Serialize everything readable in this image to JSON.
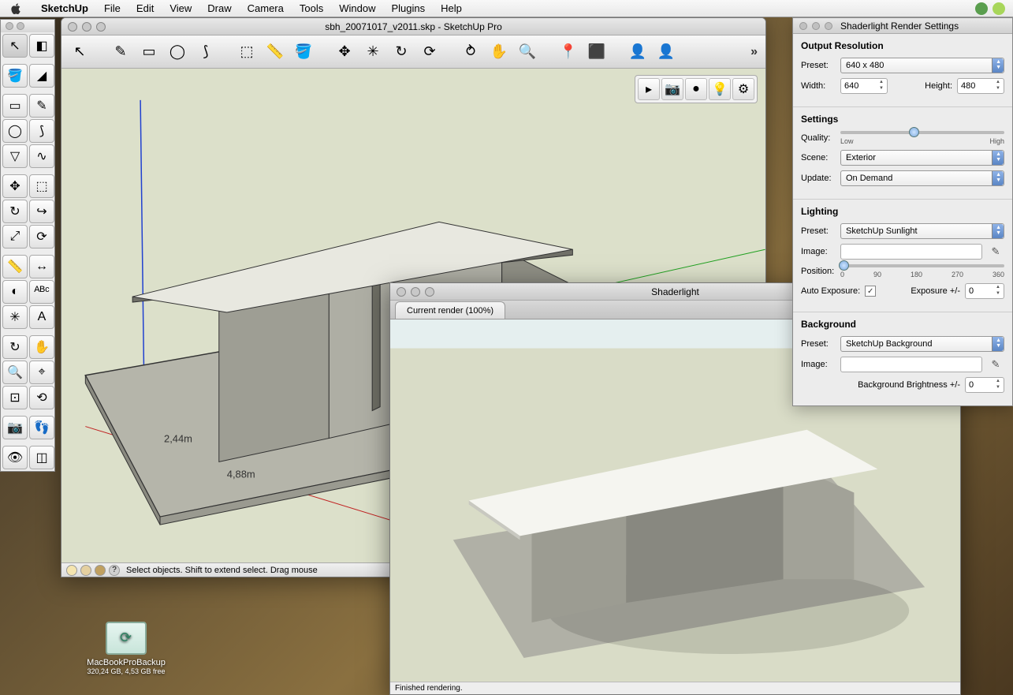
{
  "menubar": {
    "app": "SketchUp",
    "items": [
      "File",
      "Edit",
      "View",
      "Draw",
      "Camera",
      "Tools",
      "Window",
      "Plugins",
      "Help"
    ]
  },
  "doc": {
    "title": "sbh_20071017_v2011.skp - SketchUp Pro",
    "statusText": "Select objects. Shift to extend select. Drag mouse",
    "dim1": "2,44m",
    "dim2": "4,88m"
  },
  "palette": {
    "tools": [
      {
        "name": "select-tool",
        "glyph": "↖"
      },
      {
        "name": "make-component-tool",
        "glyph": "◧"
      },
      {
        "name": "paint-bucket-tool",
        "glyph": "🪣"
      },
      {
        "name": "eraser-tool",
        "glyph": "◢"
      },
      {
        "name": "rectangle-tool",
        "glyph": "▭"
      },
      {
        "name": "line-tool",
        "glyph": "✎"
      },
      {
        "name": "circle-tool",
        "glyph": "◯"
      },
      {
        "name": "arc-tool",
        "glyph": "⟆"
      },
      {
        "name": "polygon-tool",
        "glyph": "▽"
      },
      {
        "name": "freehand-tool",
        "glyph": "∿"
      },
      {
        "name": "move-tool",
        "glyph": "✥"
      },
      {
        "name": "pushpull-tool",
        "glyph": "⬚"
      },
      {
        "name": "rotate-tool",
        "glyph": "↻"
      },
      {
        "name": "followme-tool",
        "glyph": "↪"
      },
      {
        "name": "scale-tool",
        "glyph": "⤢"
      },
      {
        "name": "offset-tool",
        "glyph": "⟳"
      },
      {
        "name": "tape-tool",
        "glyph": "📏"
      },
      {
        "name": "dimension-tool",
        "glyph": "↔"
      },
      {
        "name": "protractor-tool",
        "glyph": "◐"
      },
      {
        "name": "text-tool",
        "glyph": "ᴬᴮᶜ"
      },
      {
        "name": "axes-tool",
        "glyph": "✳"
      },
      {
        "name": "3dtext-tool",
        "glyph": "A"
      },
      {
        "name": "orbit-tool",
        "glyph": "↻"
      },
      {
        "name": "pan-tool",
        "glyph": "✋"
      },
      {
        "name": "zoom-tool",
        "glyph": "🔍"
      },
      {
        "name": "zoomwindow-tool",
        "glyph": "⌖"
      },
      {
        "name": "zoomextents-tool",
        "glyph": "⊡"
      },
      {
        "name": "previous-tool",
        "glyph": "⟲"
      },
      {
        "name": "position-camera-tool",
        "glyph": "📷"
      },
      {
        "name": "walk-tool",
        "glyph": "👣"
      },
      {
        "name": "look-around-tool",
        "glyph": "👁"
      },
      {
        "name": "section-plane-tool",
        "glyph": "◫"
      }
    ]
  },
  "hToolbar": {
    "groups": [
      [
        "select-icon"
      ],
      [
        "pencil-icon",
        "rectangle-icon",
        "circle-icon",
        "arc-icon"
      ],
      [
        "pushpull-icon",
        "tape-icon",
        "paint-icon"
      ],
      [
        "move-icon",
        "rotate-icon",
        "rotate2-icon",
        "offset-icon"
      ],
      [
        "orbit-icon",
        "pan-icon",
        "zoom-icon"
      ],
      [
        "addloc-icon",
        "model-icon"
      ],
      [
        "person-icon",
        "person2-icon"
      ]
    ],
    "glyphs": {
      "select-icon": "↖",
      "pencil-icon": "✎",
      "rectangle-icon": "▭",
      "circle-icon": "◯",
      "arc-icon": "⟆",
      "pushpull-icon": "⬚",
      "tape-icon": "📏",
      "paint-icon": "🪣",
      "move-icon": "✥",
      "rotate-icon": "✳",
      "rotate2-icon": "↻",
      "offset-icon": "⟳",
      "orbit-icon": "⥁",
      "pan-icon": "✋",
      "zoom-icon": "🔍",
      "addloc-icon": "📍",
      "model-icon": "⬛",
      "person-icon": "👤",
      "person2-icon": "👤"
    }
  },
  "vpFloat": [
    "hide-icon",
    "camera-icon",
    "ball-icon",
    "bulb-icon",
    "gear-icon"
  ],
  "vpFloatGlyphs": {
    "hide-icon": "▸",
    "camera-icon": "📷",
    "ball-icon": "●",
    "bulb-icon": "💡",
    "gear-icon": "⚙"
  },
  "render": {
    "title": "Shaderlight",
    "tab": "Current render (100%)",
    "status": "Finished rendering."
  },
  "settings": {
    "title": "Shaderlight Render Settings",
    "sections": {
      "outputRes": {
        "heading": "Output Resolution",
        "presetLabel": "Preset:",
        "presetValue": "640 x 480",
        "widthLabel": "Width:",
        "widthValue": "640",
        "heightLabel": "Height:",
        "heightValue": "480"
      },
      "settings": {
        "heading": "Settings",
        "qualityLabel": "Quality:",
        "lowLabel": "Low",
        "highLabel": "High",
        "sceneLabel": "Scene:",
        "sceneValue": "Exterior",
        "updateLabel": "Update:",
        "updateValue": "On Demand"
      },
      "lighting": {
        "heading": "Lighting",
        "presetLabel": "Preset:",
        "presetValue": "SketchUp Sunlight",
        "imageLabel": "Image:",
        "positionLabel": "Position:",
        "posTicks": [
          "0",
          "90",
          "180",
          "270",
          "360"
        ],
        "autoExpLabel": "Auto Exposure:",
        "autoExpChecked": true,
        "exposureLabel": "Exposure +/-",
        "exposureValue": "0"
      },
      "background": {
        "heading": "Background",
        "presetLabel": "Preset:",
        "presetValue": "SketchUp Background",
        "imageLabel": "Image:",
        "brightnessLabel": "Background Brightness +/-",
        "brightnessValue": "0"
      }
    }
  },
  "desktop": {
    "name": "MacBookProBackup",
    "sub": "320,24 GB, 4,53 GB free"
  }
}
